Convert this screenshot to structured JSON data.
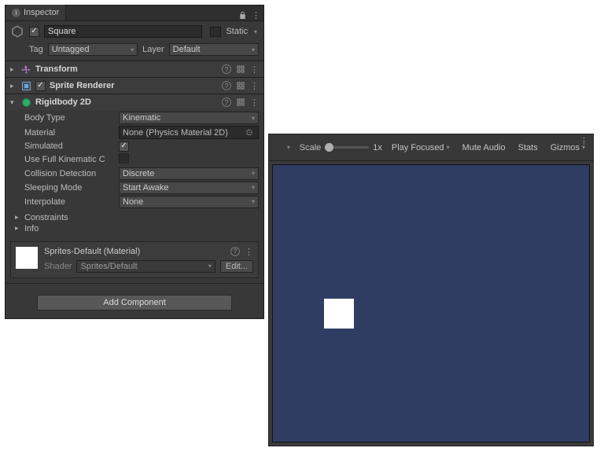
{
  "inspector": {
    "tab_label": "Inspector",
    "game_object": {
      "name": "Square",
      "enabled": true,
      "static_label": "Static",
      "tag_label": "Tag",
      "tag_value": "Untagged",
      "layer_label": "Layer",
      "layer_value": "Default"
    },
    "components": {
      "transform": {
        "title": "Transform"
      },
      "sprite_renderer": {
        "title": "Sprite Renderer"
      },
      "rigidbody2d": {
        "title": "Rigidbody 2D",
        "body_type": {
          "label": "Body Type",
          "value": "Kinematic"
        },
        "material": {
          "label": "Material",
          "value": "None (Physics Material 2D)"
        },
        "simulated": {
          "label": "Simulated",
          "checked": true
        },
        "use_full_kinematic": {
          "label": "Use Full Kinematic C"
        },
        "collision_detection": {
          "label": "Collision Detection",
          "value": "Discrete"
        },
        "sleeping_mode": {
          "label": "Sleeping Mode",
          "value": "Start Awake"
        },
        "interpolate": {
          "label": "Interpolate",
          "value": "None"
        },
        "constraints_label": "Constraints",
        "info_label": "Info"
      }
    },
    "material": {
      "title": "Sprites-Default (Material)",
      "shader_label": "Shader",
      "shader_value": "Sprites/Default",
      "edit_label": "Edit..."
    },
    "add_component_label": "Add Component"
  },
  "game_view": {
    "scale_label": "Scale",
    "scale_value": "1x",
    "play_mode": "Play Focused",
    "mute_label": "Mute Audio",
    "stats_label": "Stats",
    "gizmos_label": "Gizmos",
    "render_bg": "#2f3d63"
  }
}
